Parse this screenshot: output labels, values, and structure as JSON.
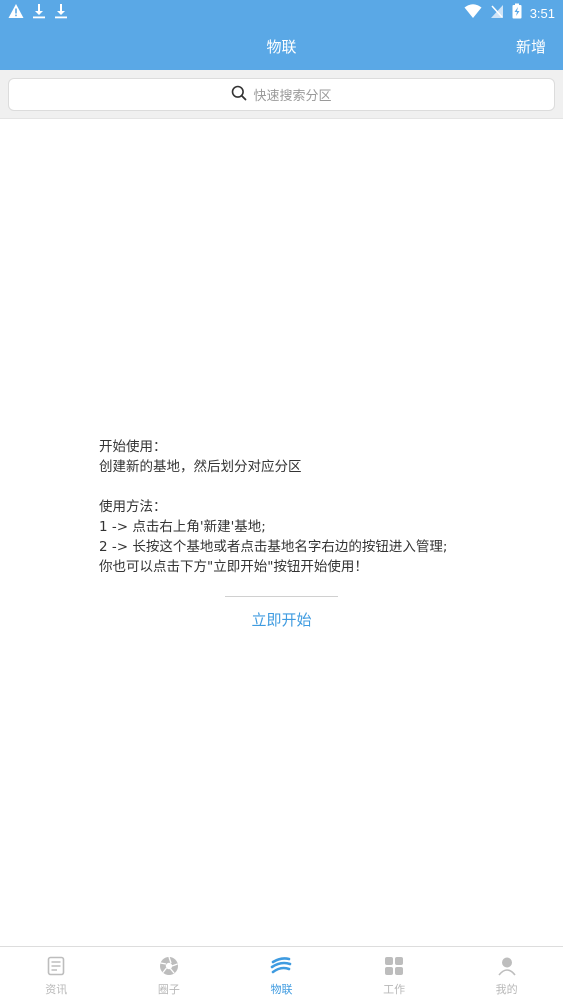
{
  "status_bar": {
    "time": "3:51"
  },
  "app_bar": {
    "title": "物联",
    "action_label": "新增"
  },
  "search": {
    "placeholder": "快速搜索分区"
  },
  "guide": {
    "line1": "开始使用：",
    "line2": "创建新的基地，然后划分对应分区",
    "line3": "使用方法：",
    "line4": "1 -> 点击右上角'新建'基地;",
    "line5": "2 -> 长按这个基地或者点击基地名字右边的按钮进入管理;",
    "line6": "你也可以点击下方\"立即开始\"按钮开始使用！"
  },
  "start_button": {
    "label": "立即开始"
  },
  "bottom_nav": {
    "items": [
      {
        "label": "资讯",
        "icon": "news-icon",
        "active": false
      },
      {
        "label": "圈子",
        "icon": "aperture-icon",
        "active": false
      },
      {
        "label": "物联",
        "icon": "iot-icon",
        "active": true
      },
      {
        "label": "工作",
        "icon": "grid-icon",
        "active": false
      },
      {
        "label": "我的",
        "icon": "user-icon",
        "active": false
      }
    ]
  },
  "colors": {
    "primary": "#5aa8e6",
    "accent": "#3f9be0",
    "inactive": "#b8b8b8"
  }
}
